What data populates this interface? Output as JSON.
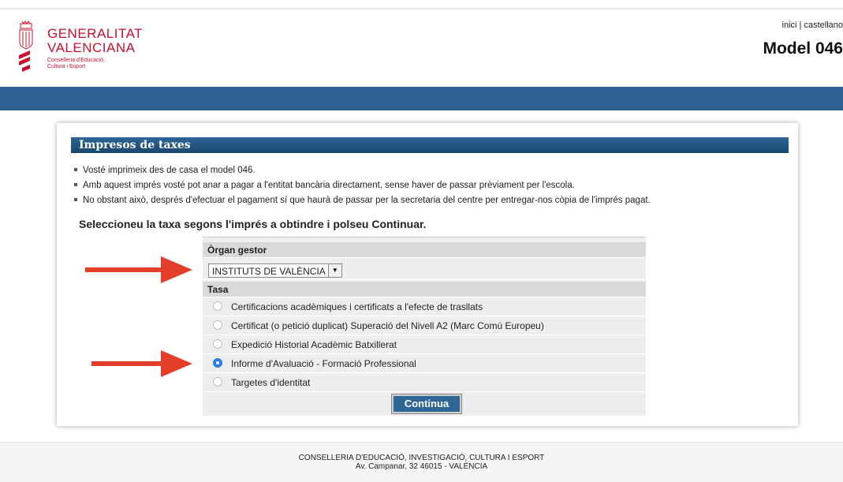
{
  "header": {
    "logo_line1": "GENERALITAT",
    "logo_line2": "VALENCIANA",
    "logo_line3": "Conselleria d'Educació,",
    "logo_line4": "Cultura i Esport",
    "link_home": "inici",
    "link_separator": " | ",
    "link_lang": "castellano",
    "model_title": "Model 046"
  },
  "section": {
    "title": "Impresos de taxes",
    "bullets": [
      "Vosté imprimeix des de casa el model 046.",
      "Amb aquest imprés vosté pot anar a pagar a l'entitat bancària directament, sense haver de passar prèviament per l'escola.",
      "No obstant això, després d'efectuar el pagament sí que haurà de passar per la secretaria del centre per entregar-nos còpia de l'imprés pagat."
    ],
    "instruction": "Seleccioneu la taxa segons l'imprés a obtindre i polseu Continuar."
  },
  "form": {
    "organ_label": "Òrgan gestor",
    "organ_value": "INSTITUTS DE VALÈNCIA",
    "tasa_label": "Tasa",
    "options": [
      {
        "label": "Certificacions acadèmiques i certificats a l'efecte de trasllats",
        "checked": false
      },
      {
        "label": "Certificat (o petició duplicat) Superació del Nivell A2 (Marc Comú Europeu)",
        "checked": false
      },
      {
        "label": "Expedició Historial Acadèmic Batxillerat",
        "checked": false
      },
      {
        "label": "Informe d'Avaluació - Formació Professional",
        "checked": true
      },
      {
        "label": "Targetes d'identitat",
        "checked": false
      }
    ],
    "continue_label": "Continua"
  },
  "footer": {
    "line1": "CONSELLERIA D'EDUCACIÓ, INVESTIGACIÓ, CULTURA I ESPORT",
    "line2": "Av. Campanar, 32 46015 - VALÈNCIA"
  },
  "colors": {
    "brand_red": "#c8102e",
    "bar_blue": "#2d6191",
    "arrow_red": "#e43d2a",
    "radio_blue": "#2a7ee8"
  }
}
